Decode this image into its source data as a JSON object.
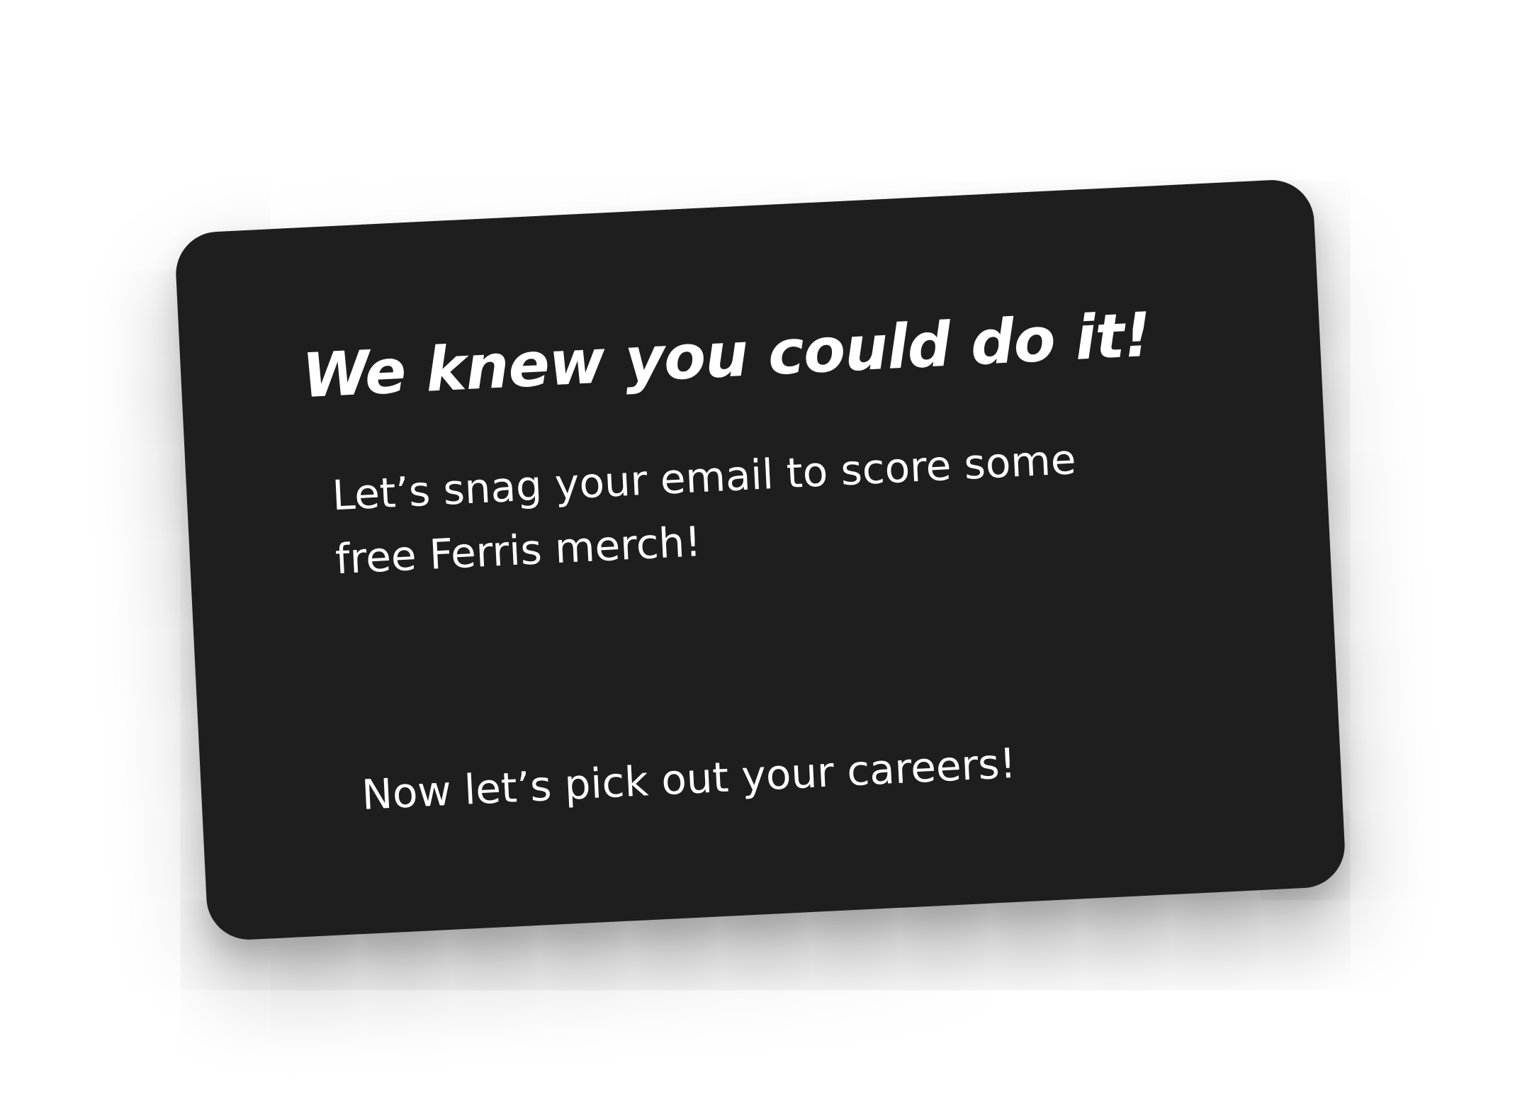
{
  "card": {
    "title": "We knew you could do it!",
    "body_line1": "Let’s snag your email to score some",
    "body_line2": "free Ferris merch!",
    "cta": "Now let’s pick out your careers!",
    "background_color": "#1e1e1e",
    "text_color": "#ffffff"
  }
}
